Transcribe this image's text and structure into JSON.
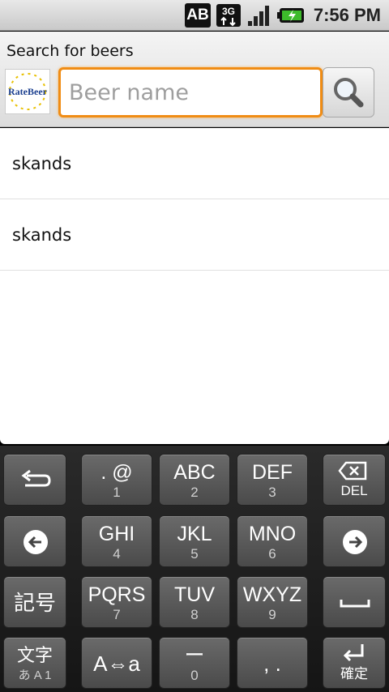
{
  "status_bar": {
    "ab_label": "AB",
    "network_label": "3G",
    "time": "7:56 PM",
    "icons": [
      "ab-input-icon",
      "3g-data-icon",
      "signal-strength-icon",
      "battery-charging-icon"
    ]
  },
  "search": {
    "title": "Search for beers",
    "logo_text": "RateBeer",
    "placeholder": "Beer name",
    "value": "",
    "accent_color": "#f08c14"
  },
  "results": [
    {
      "label": "skands"
    },
    {
      "label": "skands"
    }
  ],
  "keyboard": {
    "row1": [
      {
        "main": "",
        "sub": "",
        "icon": "undo-icon"
      },
      {
        "main": ". @",
        "sub": "1"
      },
      {
        "main": "ABC",
        "sub": "2"
      },
      {
        "main": "DEF",
        "sub": "3"
      },
      {
        "main": "",
        "sub": "DEL",
        "icon": "backspace-icon"
      }
    ],
    "row2": [
      {
        "main": "",
        "icon": "left-arrow-icon"
      },
      {
        "main": "GHI",
        "sub": "4"
      },
      {
        "main": "JKL",
        "sub": "5"
      },
      {
        "main": "MNO",
        "sub": "6"
      },
      {
        "main": "",
        "icon": "right-arrow-icon"
      }
    ],
    "row3": [
      {
        "main": "記号"
      },
      {
        "main": "PQRS",
        "sub": "7"
      },
      {
        "main": "TUV",
        "sub": "8"
      },
      {
        "main": "WXYZ",
        "sub": "9"
      },
      {
        "main": "",
        "icon": "space-icon"
      }
    ],
    "row4": [
      {
        "main": "文字",
        "sub": "あ A 1"
      },
      {
        "main": "A⇔a"
      },
      {
        "main": "ー",
        "sub": "0"
      },
      {
        "main": ", ."
      },
      {
        "main": "",
        "sub": "確定",
        "icon": "enter-icon"
      }
    ]
  }
}
